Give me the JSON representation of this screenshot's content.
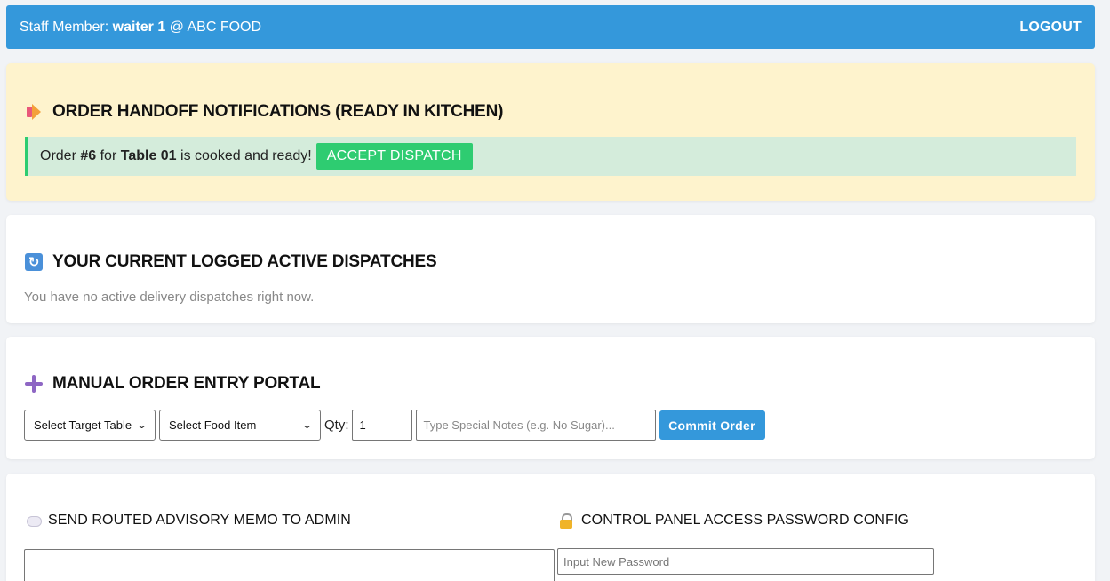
{
  "topbar": {
    "staff_prefix": "Staff Member: ",
    "staff_name": "waiter 1",
    "venue": " @ ABC FOOD",
    "logout": "LOGOUT"
  },
  "notifications": {
    "title": "ORDER HANDOFF NOTIFICATIONS (READY IN KITCHEN)",
    "alert": {
      "pre": "Order ",
      "order_no": "#6",
      "mid": " for ",
      "table": "Table 01",
      "post": " is cooked and ready!",
      "button": "ACCEPT DISPATCH"
    }
  },
  "dispatches": {
    "title": "YOUR CURRENT LOGGED ACTIVE DISPATCHES",
    "empty_text": "You have no active delivery dispatches right now."
  },
  "entry": {
    "title": "MANUAL ORDER ENTRY PORTAL",
    "table_select": "Select Target Table",
    "food_select": "Select Food Item",
    "qty_label": "Qty:",
    "qty_value": "1",
    "notes_placeholder": "Type Special Notes (e.g. No Sugar)...",
    "commit": "Commit Order"
  },
  "memo": {
    "title": "SEND ROUTED ADVISORY MEMO TO ADMIN",
    "password_title": "CONTROL PANEL ACCESS PASSWORD CONFIG",
    "password_placeholder": "Input New Password"
  },
  "colors": {
    "header": "#3498db",
    "success": "#2ecc71",
    "notif_bg": "#fef3cd",
    "alert_bg": "#d4ecdb"
  },
  "icons": [
    "megaphone-icon",
    "refresh-icon",
    "plus-icon",
    "speech-bubble-icon",
    "lock-icon",
    "chevron-down-icon"
  ]
}
